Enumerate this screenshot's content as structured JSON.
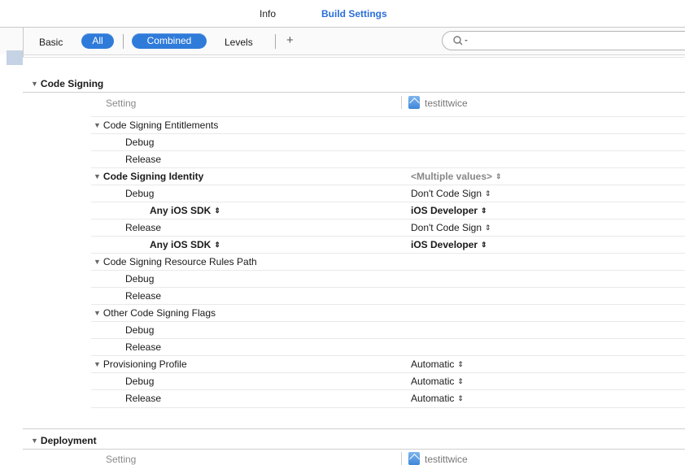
{
  "tabs": {
    "info": "Info",
    "build_settings": "Build Settings"
  },
  "filter_bar": {
    "basic": "Basic",
    "all": "All",
    "combined": "Combined",
    "levels": "Levels",
    "add": "+"
  },
  "sections": {
    "code_signing": {
      "title": "Code Signing",
      "setting_label": "Setting",
      "target": "testittwice"
    },
    "deployment": {
      "title": "Deployment",
      "setting_label": "Setting",
      "target": "testittwice"
    }
  },
  "rows": [
    {
      "name": "Code Signing Entitlements",
      "value": ""
    },
    {
      "name": "Debug",
      "value": ""
    },
    {
      "name": "Release",
      "value": ""
    },
    {
      "name": "Code Signing Identity",
      "value": "<Multiple values>"
    },
    {
      "name": "Debug",
      "value": "Don't Code Sign"
    },
    {
      "name": "Any iOS SDK",
      "value": "iOS Developer"
    },
    {
      "name": "Release",
      "value": "Don't Code Sign"
    },
    {
      "name": "Any iOS SDK",
      "value": "iOS Developer"
    },
    {
      "name": "Code Signing Resource Rules Path",
      "value": ""
    },
    {
      "name": "Debug",
      "value": ""
    },
    {
      "name": "Release",
      "value": ""
    },
    {
      "name": "Other Code Signing Flags",
      "value": ""
    },
    {
      "name": "Debug",
      "value": ""
    },
    {
      "name": "Release",
      "value": ""
    },
    {
      "name": "Provisioning Profile",
      "value": "Automatic"
    },
    {
      "name": "Debug",
      "value": "Automatic"
    },
    {
      "name": "Release",
      "value": "Automatic"
    }
  ],
  "icons": {
    "disclosure": "disclosure-triangle-icon",
    "stepper": "up-down-arrows-icon",
    "search": "search-icon",
    "target": "target-icon"
  },
  "colors": {
    "accent": "#2f7bd9",
    "tab_active": "#2a6fd8"
  }
}
